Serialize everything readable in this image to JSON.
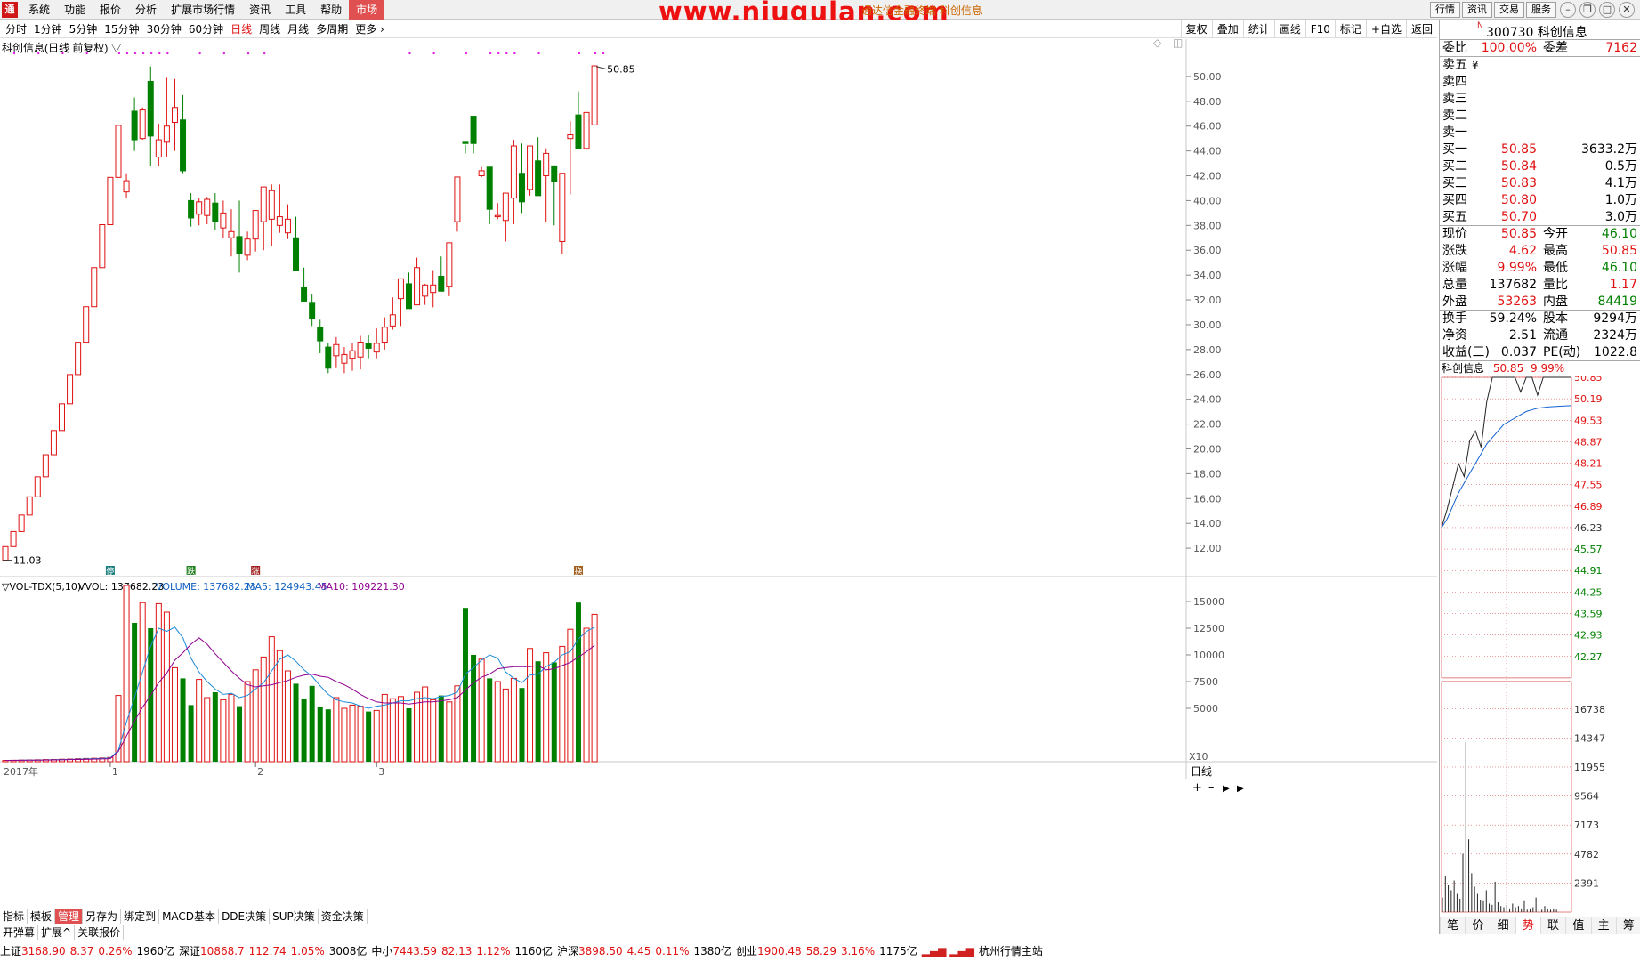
{
  "app": {
    "logo": "通",
    "watermark": "www.niugulan.com",
    "window_title": "通达信金融终端 科创信息"
  },
  "menu": [
    "系统",
    "功能",
    "报价",
    "分析",
    "扩展市场行情",
    "资讯",
    "工具",
    "帮助",
    "市场"
  ],
  "top_right": {
    "buttons": [
      "行情",
      "资讯",
      "交易",
      "服务"
    ]
  },
  "periods": [
    "分时",
    "1分钟",
    "5分钟",
    "15分钟",
    "30分钟",
    "60分钟",
    "日线",
    "周线",
    "月线",
    "多周期",
    "更多 ›"
  ],
  "periods_active": "日线",
  "tools": [
    "复权",
    "叠加",
    "统计",
    "画线",
    "F10",
    "标记",
    "+自选",
    "返回"
  ],
  "chart_title": "科创信息(日线 前复权) ▽",
  "high_label": "50.85",
  "low_label": "11.03",
  "period_label": "日线",
  "x10": "X10",
  "year_label": "2017年",
  "month_labels": [
    "1",
    "2",
    "3"
  ],
  "signals": [
    {
      "text": "停",
      "color": "#208080"
    },
    {
      "text": "跌",
      "color": "#208020"
    },
    {
      "text": "涨",
      "color": "#a02020"
    },
    {
      "text": "换",
      "color": "#a06020"
    }
  ],
  "vol_header": {
    "name": "▽VOL-TDX(5,10)",
    "vvol": "VVOL: 137682.23",
    "volume": "VOLUME: 137682.23",
    "ma5": "MA5: 124943.45",
    "ma10": "MA10: 109221.30"
  },
  "chart_data": [
    {
      "type": "candlestick",
      "title": "科创信息(日线 前复权)",
      "ylim": [
        10,
        52
      ],
      "yticks": [
        12,
        14,
        16,
        18,
        20,
        22,
        24,
        26,
        28,
        30,
        32,
        34,
        36,
        38,
        40,
        42,
        44,
        46,
        48,
        50
      ],
      "ohlc": [
        [
          11.03,
          12.13,
          11.03,
          12.13
        ],
        [
          12.13,
          13.34,
          12.13,
          13.34
        ],
        [
          13.34,
          14.67,
          13.34,
          14.67
        ],
        [
          14.67,
          16.14,
          14.67,
          16.14
        ],
        [
          16.14,
          17.75,
          16.14,
          17.75
        ],
        [
          17.75,
          19.53,
          17.75,
          19.53
        ],
        [
          19.53,
          21.48,
          19.53,
          21.48
        ],
        [
          21.48,
          23.63,
          21.48,
          23.63
        ],
        [
          23.63,
          25.99,
          23.63,
          25.99
        ],
        [
          25.99,
          28.59,
          25.99,
          28.59
        ],
        [
          28.59,
          31.45,
          28.59,
          31.45
        ],
        [
          31.45,
          34.6,
          31.45,
          34.6
        ],
        [
          34.6,
          38.06,
          34.6,
          38.06
        ],
        [
          38.06,
          41.87,
          38.06,
          41.87
        ],
        [
          41.87,
          46.06,
          41.87,
          46.06
        ],
        [
          40.7,
          42.2,
          40.2,
          41.6
        ],
        [
          47.2,
          48.3,
          44.0,
          44.9
        ],
        [
          45.0,
          47.5,
          44.9,
          47.3
        ],
        [
          49.6,
          50.8,
          42.8,
          45.2
        ],
        [
          43.5,
          46.2,
          42.8,
          44.9
        ],
        [
          44.7,
          49.9,
          43.5,
          46.0
        ],
        [
          46.3,
          49.8,
          44.0,
          47.5
        ],
        [
          46.5,
          48.5,
          42.2,
          42.4
        ],
        [
          40.0,
          40.6,
          37.9,
          38.6
        ],
        [
          38.9,
          40.2,
          38.0,
          39.9
        ],
        [
          38.8,
          40.3,
          38.1,
          40.1
        ],
        [
          39.8,
          40.6,
          37.6,
          38.3
        ],
        [
          37.8,
          40.0,
          37.0,
          39.0
        ],
        [
          37.0,
          39.3,
          35.5,
          37.5
        ],
        [
          37.1,
          40.0,
          34.2,
          35.7
        ],
        [
          35.6,
          37.5,
          35.2,
          36.9
        ],
        [
          36.9,
          39.0,
          35.9,
          39.2
        ],
        [
          38.3,
          40.4,
          36.0,
          41.1
        ],
        [
          38.5,
          41.3,
          36.3,
          40.8
        ],
        [
          38.0,
          41.3,
          37.4,
          38.7
        ],
        [
          37.4,
          39.7,
          36.9,
          38.5
        ],
        [
          37.0,
          38.7,
          34.3,
          34.4
        ],
        [
          33.0,
          34.6,
          31.9,
          31.9
        ],
        [
          31.8,
          32.5,
          29.9,
          30.5
        ],
        [
          29.8,
          30.4,
          27.7,
          28.7
        ],
        [
          28.2,
          28.5,
          26.1,
          26.5
        ],
        [
          27.5,
          29.0,
          26.5,
          28.4
        ],
        [
          26.9,
          28.2,
          26.1,
          27.6
        ],
        [
          27.3,
          28.5,
          26.3,
          27.9
        ],
        [
          27.4,
          29.1,
          26.4,
          28.6
        ],
        [
          28.5,
          29.2,
          27.3,
          28.1
        ],
        [
          27.8,
          29.7,
          27.3,
          28.5
        ],
        [
          28.6,
          30.6,
          28.0,
          29.8
        ],
        [
          29.9,
          32.2,
          29.6,
          30.8
        ],
        [
          32.1,
          33.5,
          29.9,
          33.7
        ],
        [
          33.3,
          34.2,
          31.5,
          31.3
        ],
        [
          31.6,
          35.4,
          32.9,
          34.6
        ],
        [
          32.3,
          33.3,
          31.6,
          33.2
        ],
        [
          32.6,
          34.4,
          31.4,
          33.2
        ],
        [
          33.9,
          35.5,
          32.9,
          32.7
        ],
        [
          33.1,
          35.6,
          32.3,
          36.6
        ],
        [
          38.3,
          41.1,
          37.5,
          41.9
        ],
        [
          44.7,
          44.5,
          43.8,
          44.6
        ],
        [
          46.8,
          46.0,
          43.8,
          44.6
        ],
        [
          42.0,
          42.7,
          41.9,
          42.4
        ],
        [
          42.7,
          40.4,
          38.1,
          39.3
        ],
        [
          38.7,
          39.8,
          38.5,
          38.8
        ],
        [
          38.4,
          39.3,
          36.7,
          40.6
        ],
        [
          40.2,
          44.9,
          38.1,
          44.4
        ],
        [
          42.2,
          44.6,
          39.0,
          39.9
        ],
        [
          40.9,
          43.6,
          40.4,
          44.4
        ],
        [
          43.2,
          45.1,
          40.6,
          40.4
        ],
        [
          42.0,
          44.2,
          38.3,
          43.8
        ],
        [
          42.8,
          42.3,
          38.0,
          41.5
        ],
        [
          36.7,
          41.4,
          35.7,
          42.2
        ],
        [
          45.0,
          46.4,
          40.5,
          45.3
        ],
        [
          46.9,
          48.8,
          45.8,
          44.2
        ],
        [
          44.2,
          46.1,
          44.1,
          47.1
        ],
        [
          46.1,
          50.8,
          46.1,
          50.85
        ]
      ]
    },
    {
      "type": "bar",
      "title": "VOL-TDX(5,10)",
      "ylim": [
        0,
        17000
      ],
      "yticks": [
        5000,
        7500,
        10000,
        12500,
        15000
      ],
      "values": [
        120,
        135,
        150,
        165,
        180,
        200,
        210,
        230,
        250,
        280,
        300,
        320,
        350,
        400,
        6200,
        16500,
        13000,
        14900,
        12500,
        14800,
        14000,
        8800,
        7800,
        5300,
        7700,
        6000,
        6500,
        5800,
        6300,
        5200,
        7500,
        8600,
        9800,
        11700,
        10400,
        8500,
        7300,
        5900,
        7100,
        5100,
        4900,
        6000,
        5000,
        5300,
        5200,
        4700,
        4800,
        6300,
        5900,
        6100,
        5000,
        6500,
        7000,
        5800,
        6200,
        5600,
        7100,
        14400,
        10000,
        9600,
        7800,
        7500,
        6800,
        7800,
        6900,
        10600,
        9400,
        10200,
        9300,
        10800,
        12400,
        14900,
        12500,
        13800
      ],
      "series": [
        {
          "name": "MA5",
          "values": [
            120,
            127,
            135,
            142,
            150,
            167,
            183,
            202,
            220,
            244,
            264,
            286,
            314,
            340,
            1054,
            3700,
            6000,
            8400,
            10800,
            12500,
            12200,
            12600,
            11600,
            9700,
            8400,
            7500,
            6800,
            6300,
            6400,
            6000,
            6200,
            6800,
            7400,
            8500,
            9600,
            10000,
            9400,
            8600,
            8000,
            7100,
            6300,
            5800,
            5600,
            5500,
            5200,
            5000,
            5200,
            5300,
            5500,
            5700,
            5700,
            5900,
            6000,
            5900,
            6100,
            6200,
            6500,
            8200,
            8800,
            9500,
            10000,
            9700,
            8400,
            7800,
            7400,
            8100,
            8200,
            8900,
            9300,
            10000,
            10300,
            11500,
            12200,
            12600
          ]
        },
        {
          "name": "MA10",
          "values": [
            120,
            127,
            135,
            142,
            150,
            160,
            170,
            181,
            193,
            205,
            222,
            239,
            258,
            279,
            950,
            2400,
            3800,
            5100,
            6200,
            7400,
            8300,
            9500,
            10200,
            11000,
            11600,
            11000,
            10100,
            9300,
            8500,
            7800,
            7200,
            7000,
            7100,
            7200,
            7400,
            7600,
            7900,
            8100,
            8200,
            8000,
            7900,
            7500,
            7200,
            6800,
            6300,
            5900,
            5600,
            5500,
            5500,
            5500,
            5400,
            5500,
            5600,
            5600,
            5700,
            5800,
            6000,
            6700,
            7400,
            7900,
            8200,
            8700,
            8800,
            8900,
            8900,
            8900,
            9000,
            8600,
            8700,
            9000,
            9300,
            9800,
            10300,
            10900
          ]
        }
      ]
    },
    {
      "type": "line",
      "title": "科创信息 分时",
      "ylim": [
        41.61,
        50.85
      ],
      "yticks_price": [
        50.85,
        50.19,
        49.53,
        48.87,
        48.21,
        47.55,
        46.89,
        46.23,
        45.57,
        44.91,
        44.25,
        43.59,
        42.93,
        42.27
      ],
      "yticks_vol": [
        16738,
        14347,
        11955,
        9564,
        7173,
        4782,
        2391
      ],
      "series": [
        {
          "name": "price",
          "values": [
            46.23,
            46.8,
            47.5,
            48.2,
            47.8,
            48.9,
            49.2,
            48.7,
            50.1,
            50.85,
            50.85,
            50.85,
            50.85,
            50.85,
            50.4,
            50.85,
            50.85,
            50.3,
            50.85,
            50.85,
            50.85,
            50.85,
            50.85,
            50.85
          ]
        },
        {
          "name": "avg",
          "values": [
            46.23,
            46.5,
            46.9,
            47.3,
            47.6,
            47.9,
            48.2,
            48.5,
            48.8,
            49.0,
            49.2,
            49.4,
            49.5,
            49.6,
            49.7,
            49.8,
            49.85,
            49.9,
            49.92,
            49.94,
            49.95,
            49.96,
            49.97,
            49.98
          ]
        }
      ]
    }
  ],
  "quote": {
    "flag": "N",
    "code_name": "300730 科创信息",
    "weibi": {
      "label": "委比",
      "value": "100.00%",
      "label2": "委差",
      "value2": "7162"
    },
    "asks": [
      {
        "label": "卖五",
        "price": "",
        "vol": "",
        "mark": "¥"
      },
      {
        "label": "卖四",
        "price": "",
        "vol": ""
      },
      {
        "label": "卖三",
        "price": "",
        "vol": ""
      },
      {
        "label": "卖二",
        "price": "",
        "vol": ""
      },
      {
        "label": "卖一",
        "price": "",
        "vol": ""
      }
    ],
    "bids": [
      {
        "label": "买一",
        "price": "50.85",
        "vol": "3633.2万"
      },
      {
        "label": "买二",
        "price": "50.84",
        "vol": "0.5万"
      },
      {
        "label": "买三",
        "price": "50.83",
        "vol": "4.1万"
      },
      {
        "label": "买四",
        "price": "50.80",
        "vol": "1.0万"
      },
      {
        "label": "买五",
        "price": "50.70",
        "vol": "3.0万"
      }
    ],
    "stats1": [
      {
        "l": "现价",
        "m": "50.85",
        "mc": "red",
        "l2": "今开",
        "r": "46.10",
        "rc": "green"
      },
      {
        "l": "涨跌",
        "m": "4.62",
        "mc": "red",
        "l2": "最高",
        "r": "50.85",
        "rc": "red"
      },
      {
        "l": "涨幅",
        "m": "9.99%",
        "mc": "red",
        "l2": "最低",
        "r": "46.10",
        "rc": "green"
      },
      {
        "l": "总量",
        "m": "137682",
        "mc": "",
        "l2": "量比",
        "r": "1.17",
        "rc": "red"
      },
      {
        "l": "外盘",
        "m": "53263",
        "mc": "red",
        "l2": "内盘",
        "r": "84419",
        "rc": "green"
      }
    ],
    "stats2": [
      {
        "l": "换手",
        "m": "59.24%",
        "mc": "",
        "l2": "股本",
        "r": "9294万",
        "rc": ""
      },
      {
        "l": "净资",
        "m": "2.51",
        "mc": "",
        "l2": "流通",
        "r": "2324万",
        "rc": ""
      },
      {
        "l": "收益(三)",
        "m": "0.037",
        "mc": "",
        "l2": "PE(动)",
        "r": "1022.8",
        "rc": ""
      }
    ],
    "tick_head": {
      "name": "科创信息",
      "price": "50.85",
      "pct": "9.99%"
    },
    "tabs": [
      "笔",
      "价",
      "细",
      "势",
      "联",
      "值",
      "主",
      "筹"
    ],
    "tab_active": "势"
  },
  "bottom_tabs1": [
    "指标",
    "模板",
    "管理",
    "另存为",
    "绑定到",
    "MACD基本",
    "DDE决策",
    "SUP决策",
    "资金决策"
  ],
  "bottom_tabs1_active": "管理",
  "bottom_tabs2": [
    "开弹幕",
    "扩展^",
    "关联报价"
  ],
  "ticker": [
    {
      "n": "上证",
      "p": "3168.90",
      "c": "8.37",
      "pct": "0.26%",
      "amt": "1960亿"
    },
    {
      "n": "深证",
      "p": "10868.7",
      "c": "112.74",
      "pct": "1.05%",
      "amt": "3008亿"
    },
    {
      "n": "中小",
      "p": "7443.59",
      "c": "82.13",
      "pct": "1.12%",
      "amt": "1160亿"
    },
    {
      "n": "沪深",
      "p": "3898.50",
      "c": "4.45",
      "pct": "0.11%",
      "amt": "1380亿"
    },
    {
      "n": "创业",
      "p": "1900.48",
      "c": "58.29",
      "pct": "3.16%",
      "amt": "1175亿"
    }
  ],
  "station": "杭州行情主站"
}
